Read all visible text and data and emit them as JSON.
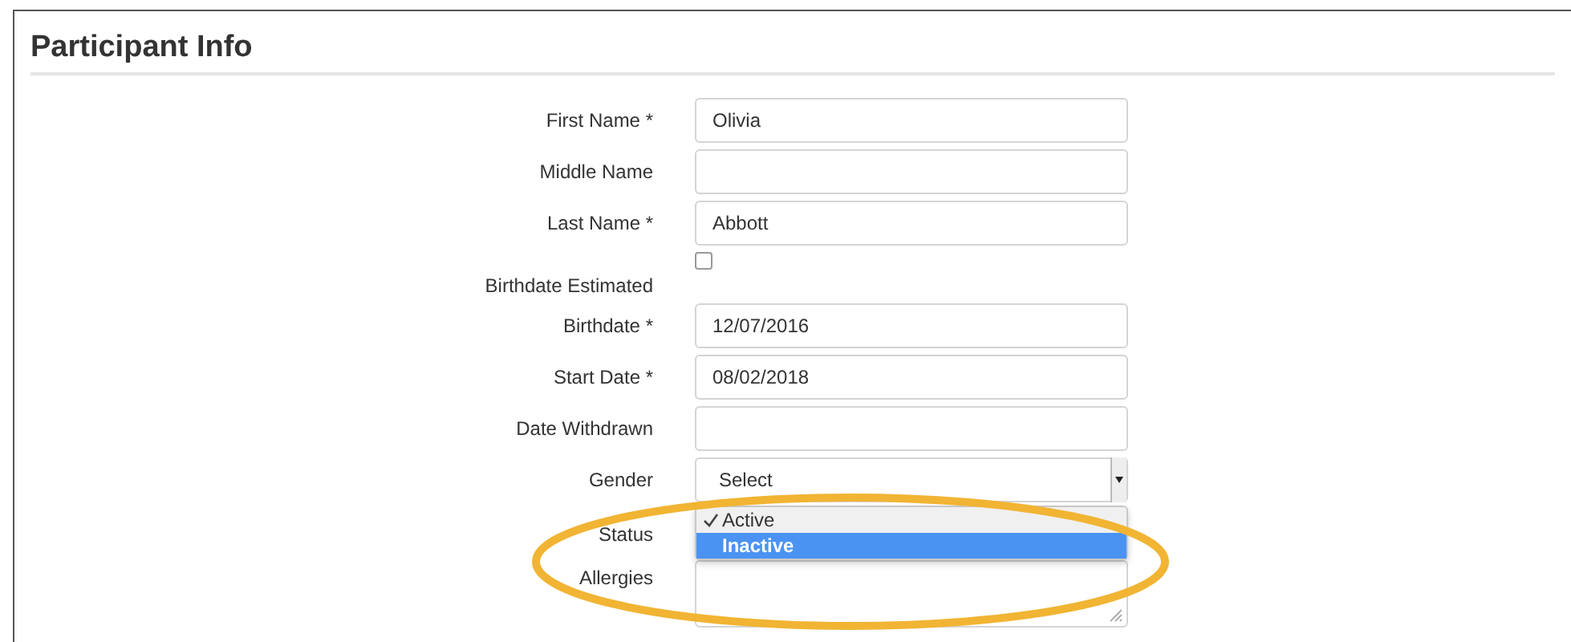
{
  "section": {
    "title": "Participant Info"
  },
  "fields": [
    {
      "kind": "text",
      "label": "First Name *",
      "value": "Olivia"
    },
    {
      "kind": "text",
      "label": "Middle Name"
    },
    {
      "kind": "text",
      "label": "Last Name *",
      "value": "Abbott"
    },
    {
      "kind": "checkbox",
      "label": "Birthdate Estimated",
      "checked": false
    },
    {
      "kind": "text",
      "label": "Birthdate *",
      "value": "12/07/2016"
    },
    {
      "kind": "text",
      "label": "Start Date *",
      "value": "08/02/2018"
    },
    {
      "kind": "text",
      "label": "Date Withdrawn"
    },
    {
      "kind": "select",
      "label": "Gender",
      "value": "Select"
    },
    {
      "kind": "open-select",
      "label": "Status",
      "options": [
        {
          "label": "Active",
          "selected": true,
          "highlighted": false
        },
        {
          "label": "Inactive",
          "selected": false,
          "highlighted": true
        }
      ]
    },
    {
      "kind": "textarea",
      "label": "Allergies"
    }
  ],
  "annotation": {
    "kind": "ellipse"
  }
}
